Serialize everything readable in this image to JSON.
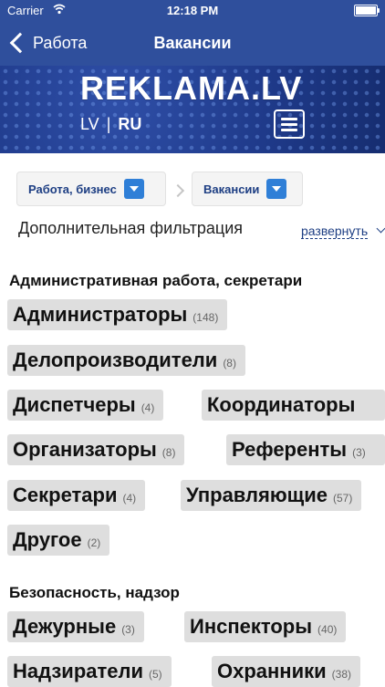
{
  "status_bar": {
    "carrier": "Carrier",
    "time": "12:18 PM"
  },
  "nav": {
    "back_label": "Работа",
    "title": "Вакансии"
  },
  "banner": {
    "logo_text": "REKLAMA.LV",
    "lang_lv": "LV",
    "lang_sep": "|",
    "lang_ru": "RU"
  },
  "filters": {
    "category": "Работа, бизнес",
    "subcategory": "Вакансии",
    "extra_filter_label": "Дополнительная фильтрация",
    "expand_label": "развернуть"
  },
  "sections": [
    {
      "title": "Административная работа, секретари",
      "items": [
        {
          "name": "Администраторы",
          "count": "(148)"
        },
        {
          "name": "Делопроизводители",
          "count": "(8)"
        },
        {
          "name": "Диспетчеры",
          "count": "(4)"
        },
        {
          "name": "Координаторы",
          "count": ""
        },
        {
          "name": "Организаторы",
          "count": "(8)"
        },
        {
          "name": "Референты",
          "count": "(3)"
        },
        {
          "name": "Секретари",
          "count": "(4)"
        },
        {
          "name": "Управляющие",
          "count": "(57)"
        },
        {
          "name": "Другое",
          "count": "(2)"
        }
      ]
    },
    {
      "title": "Безопасность, надзор",
      "items": [
        {
          "name": "Дежурные",
          "count": "(3)"
        },
        {
          "name": "Инспекторы",
          "count": "(40)"
        },
        {
          "name": "Надзиратели",
          "count": "(5)"
        },
        {
          "name": "Охранники",
          "count": "(38)"
        }
      ]
    }
  ],
  "colors": {
    "nav_bg": "#2f4f9c",
    "accent_blue": "#2f7fd7",
    "link": "#1d3e83",
    "chip_bg": "#dedede"
  }
}
